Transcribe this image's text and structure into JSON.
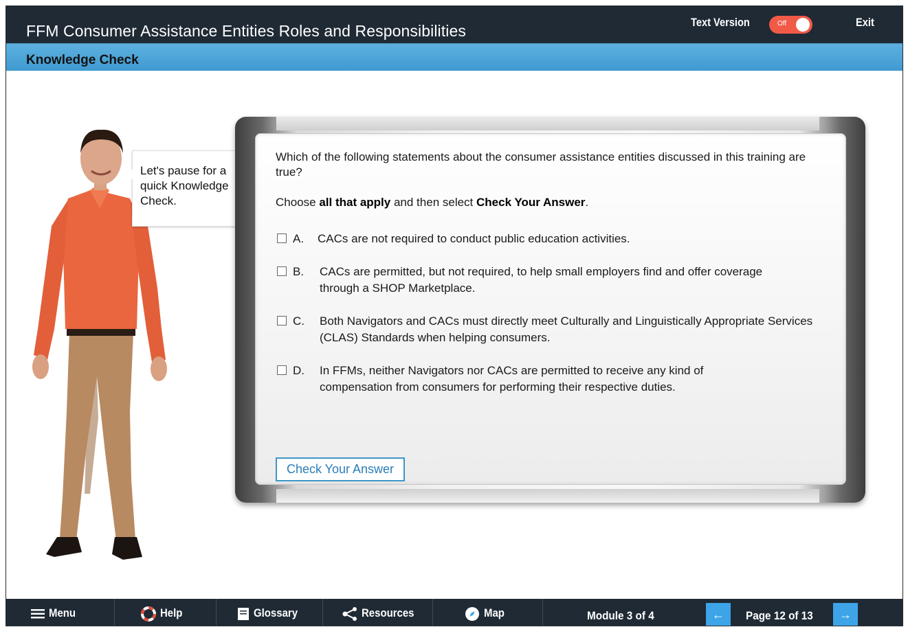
{
  "header": {
    "course_title": "FFM Consumer Assistance Entities Roles and Responsibilities",
    "text_version_label": "Text Version",
    "toggle_state": "Off",
    "exit_label": "Exit"
  },
  "section": {
    "title": "Knowledge Check"
  },
  "bubble": {
    "text": "Let's pause for a quick Knowledge Check."
  },
  "question": {
    "prompt": "Which of the following statements about the consumer assistance entities discussed in this training are true?",
    "instruction_pre": "Choose ",
    "instruction_bold1": "all that apply",
    "instruction_mid": " and then select ",
    "instruction_bold2": "Check Your Answer",
    "instruction_post": ".",
    "options": [
      {
        "letter": "A.",
        "text": "CACs are not required to conduct public education activities.",
        "checked": false
      },
      {
        "letter": "B.",
        "text": "CACs are permitted, but not required, to help small employers find and offer coverage through a SHOP Marketplace.",
        "checked": false
      },
      {
        "letter": "C.",
        "text": "Both Navigators and CACs must directly meet Culturally and Linguistically Appropriate Services (CLAS) Standards when helping consumers.",
        "checked": false
      },
      {
        "letter": "D.",
        "text": "In FFMs, neither Navigators nor CACs are permitted to receive any kind of compensation from consumers for performing their respective duties.",
        "checked": false
      }
    ],
    "check_button": "Check Your Answer"
  },
  "footer": {
    "menu": "Menu",
    "help": "Help",
    "glossary": "Glossary",
    "resources": "Resources",
    "map": "Map",
    "module": "Module 3 of 4",
    "page": "Page 12 of 13",
    "prev_icon": "←",
    "next_icon": "→"
  },
  "colors": {
    "header_bg": "#1f2a35",
    "section_bar": "#4aa4d8",
    "toggle_off": "#f05a47",
    "nav_button": "#3da4e8",
    "check_button_border": "#3d95c9"
  }
}
